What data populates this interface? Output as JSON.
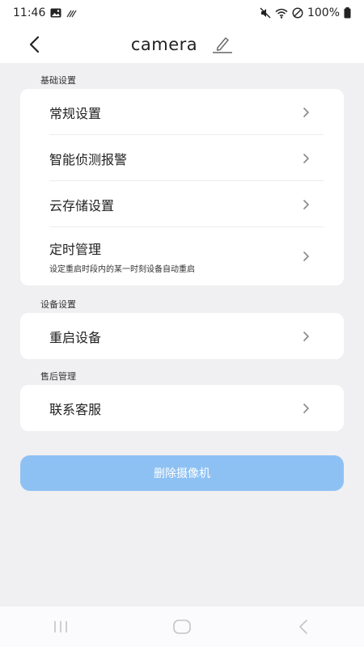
{
  "status_bar": {
    "time": "11:46",
    "battery": "100%",
    "icons": [
      "image-icon",
      "signal-waves-icon",
      "mute-icon",
      "wifi-icon",
      "dnd-icon",
      "battery-icon"
    ]
  },
  "header": {
    "title": "camera",
    "back_icon": "chevron-left-icon",
    "edit_icon": "pencil-icon"
  },
  "sections": {
    "basic": {
      "label": "基础设置",
      "items": [
        {
          "label": "常规设置"
        },
        {
          "label": "智能侦测报警"
        },
        {
          "label": "云存储设置"
        },
        {
          "label": "定时管理",
          "sub": "设定重启时段内的某一时刻设备自动重启"
        }
      ]
    },
    "device": {
      "label": "设备设置",
      "items": [
        {
          "label": "重启设备"
        }
      ]
    },
    "after_sales": {
      "label": "售后管理",
      "items": [
        {
          "label": "联系客服"
        }
      ]
    }
  },
  "delete_button": {
    "label": "删除摄像机"
  },
  "colors": {
    "background": "#f0eff1",
    "card": "#ffffff",
    "accent_button": "#8ec1f3",
    "text": "#222222",
    "chevron": "#888888"
  },
  "nav_bar": {
    "icons": [
      "recents-icon",
      "home-icon",
      "back-icon"
    ]
  }
}
